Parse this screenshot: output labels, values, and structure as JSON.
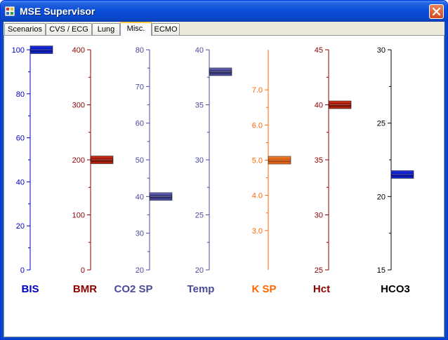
{
  "window": {
    "title": "MSE Supervisor"
  },
  "tabs": [
    {
      "label": "Scenarios",
      "active": false
    },
    {
      "label": "CVS / ECG",
      "active": false
    },
    {
      "label": "Lung",
      "active": false
    },
    {
      "label": "Misc.",
      "active": true
    },
    {
      "label": "ECMO",
      "active": false
    }
  ],
  "gauges": [
    {
      "label": "BIS",
      "min": 0,
      "max": 100,
      "ticks": [
        "0",
        "20",
        "40",
        "60",
        "80",
        "100"
      ],
      "value": 100,
      "color": "#0000c0",
      "marker": "blue"
    },
    {
      "label": "BMR",
      "min": 0,
      "max": 400,
      "ticks": [
        "0",
        "100",
        "200",
        "300",
        "400"
      ],
      "value": 200,
      "color": "#8b0000",
      "marker": "red"
    },
    {
      "label": "CO2 SP",
      "min": 20,
      "max": 80,
      "ticks": [
        "20",
        "30",
        "40",
        "50",
        "60",
        "70",
        "80"
      ],
      "value": 40,
      "color": "#4a4a9a",
      "marker": "slate"
    },
    {
      "label": "Temp",
      "min": 20,
      "max": 40,
      "ticks": [
        "20",
        "25",
        "30",
        "35",
        "40"
      ],
      "value": 38,
      "color": "#4a4a9a",
      "marker": "slate"
    },
    {
      "label": "K SP",
      "min": 2.5,
      "max": 7.5,
      "ticks": [
        "3.0",
        "4.0",
        "5.0",
        "6.0",
        "7.0"
      ],
      "value": 5.0,
      "color": "#ff6600",
      "marker": "orange"
    },
    {
      "label": "Hct",
      "min": 25,
      "max": 45,
      "ticks": [
        "25",
        "30",
        "35",
        "40",
        "45"
      ],
      "value": 40,
      "color": "#8b0000",
      "marker": "red"
    },
    {
      "label": "HCO3",
      "min": 15,
      "max": 30,
      "ticks": [
        "15",
        "20",
        "25",
        "30"
      ],
      "value": 21.5,
      "color": "#000000",
      "marker": "blue"
    }
  ]
}
